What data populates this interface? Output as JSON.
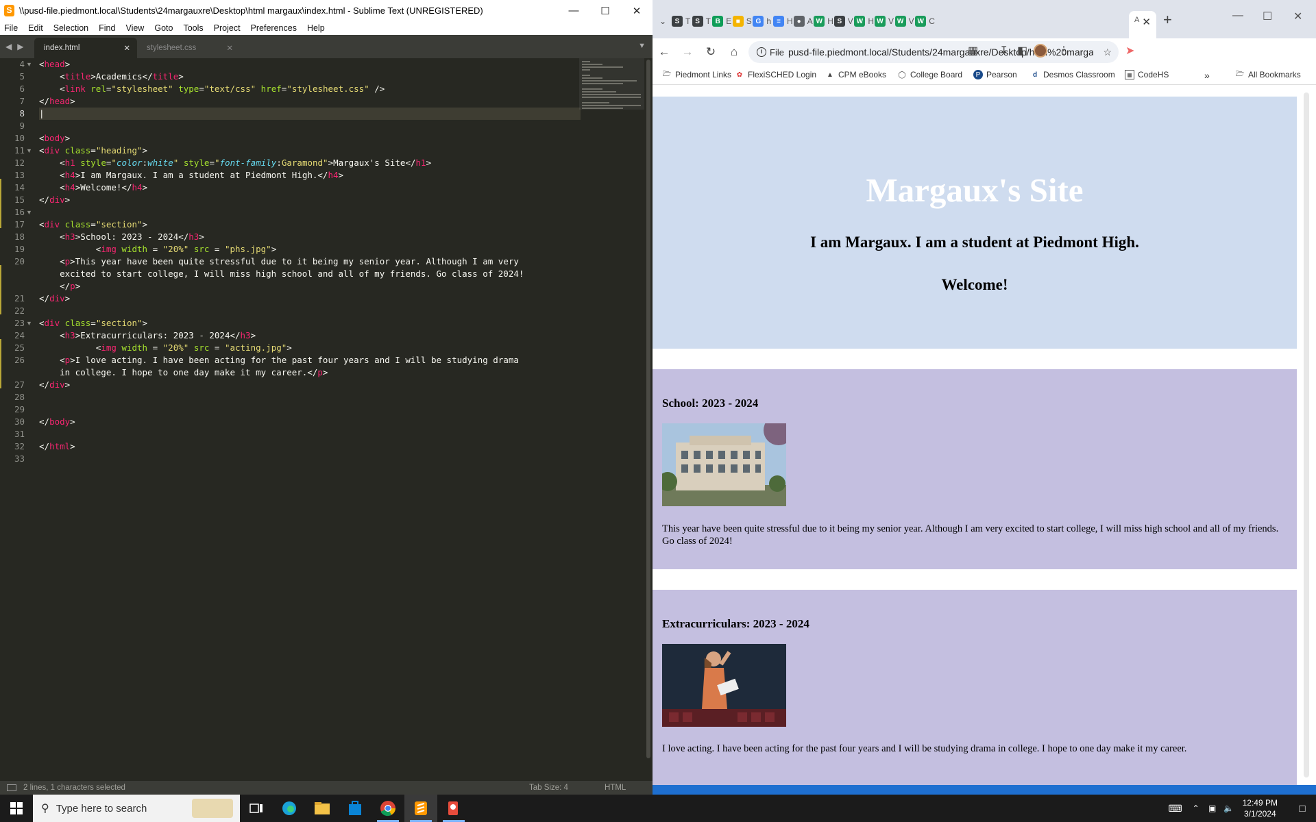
{
  "sublime": {
    "title": "\\\\pusd-file.piedmont.local\\Students\\24margauxre\\Desktop\\html margaux\\index.html - Sublime Text (UNREGISTERED)",
    "menu": [
      "File",
      "Edit",
      "Selection",
      "Find",
      "View",
      "Goto",
      "Tools",
      "Project",
      "Preferences",
      "Help"
    ],
    "tabs": [
      {
        "label": "index.html",
        "active": true
      },
      {
        "label": "stylesheet.css",
        "active": false
      }
    ],
    "line_numbers": [
      "4",
      "5",
      "6",
      "7",
      "8",
      "9",
      "10",
      "11",
      "12",
      "13",
      "14",
      "15",
      "16",
      "17",
      "18",
      "19",
      "20",
      "",
      "",
      "21",
      "22",
      "23",
      "24",
      "25",
      "26",
      "",
      "27",
      "28",
      "29",
      "30",
      "31",
      "32",
      "33"
    ],
    "status_left": "2 lines, 1 characters selected",
    "status_tab": "Tab Size: 4",
    "status_syntax": "HTML"
  },
  "chrome": {
    "url": "pusd-file.piedmont.local/Students/24margauxre/Desktop/html%20margau...",
    "info_label": "File",
    "tabs": [
      {
        "letter": "S",
        "label": "T",
        "color": "#3c4043"
      },
      {
        "letter": "S",
        "label": "T",
        "color": "#3c4043"
      },
      {
        "letter": "B",
        "label": "E",
        "color": "#0f9d58"
      },
      {
        "letter": "■",
        "label": "S",
        "color": "#f4b400"
      },
      {
        "letter": "G",
        "label": "h",
        "color": "#4285f4"
      },
      {
        "letter": "≡",
        "label": "H",
        "color": "#4285f4"
      },
      {
        "letter": "●",
        "label": "A",
        "color": "#5f6368"
      },
      {
        "letter": "W",
        "label": "H",
        "color": "#1a9c5b"
      },
      {
        "letter": "S",
        "label": "V",
        "color": "#3c4043"
      },
      {
        "letter": "W",
        "label": "H",
        "color": "#1a9c5b"
      },
      {
        "letter": "W",
        "label": "V",
        "color": "#1a9c5b"
      },
      {
        "letter": "W",
        "label": "V",
        "color": "#1a9c5b"
      },
      {
        "letter": "W",
        "label": "C",
        "color": "#1a9c5b"
      }
    ],
    "active_tab_label": "A",
    "bookmarks": [
      {
        "icon": "folder-icon",
        "label": "Piedmont Links"
      },
      {
        "icon": "flexisched-icon",
        "label": "FlexiSCHED Login"
      },
      {
        "icon": "cpm-icon",
        "label": "CPM eBooks"
      },
      {
        "icon": "college-board-icon",
        "label": "College Board"
      },
      {
        "icon": "pearson-icon",
        "label": "Pearson"
      },
      {
        "icon": "desmos-icon",
        "label": "Desmos Classroom"
      },
      {
        "icon": "codehs-icon",
        "label": "CodeHS"
      }
    ],
    "all_bookmarks": "All Bookmarks"
  },
  "page": {
    "h1": "Margaux's Site",
    "h4a": "I am Margaux. I am a student at Piedmont High.",
    "h4b": "Welcome!",
    "section1": {
      "title": "School: 2023 - 2024",
      "text": "This year have been quite stressful due to it being my senior year. Although I am very excited to start college, I will miss high school and all of my friends. Go class of 2024!"
    },
    "section2": {
      "title": "Extracurriculars: 2023 - 2024",
      "text": "I love acting. I have been acting for the past four years and I will be studying drama in college. I hope to one day make it my career."
    }
  },
  "taskbar": {
    "search_placeholder": "Type here to search",
    "time": "12:49 PM",
    "date": "3/1/2024"
  }
}
